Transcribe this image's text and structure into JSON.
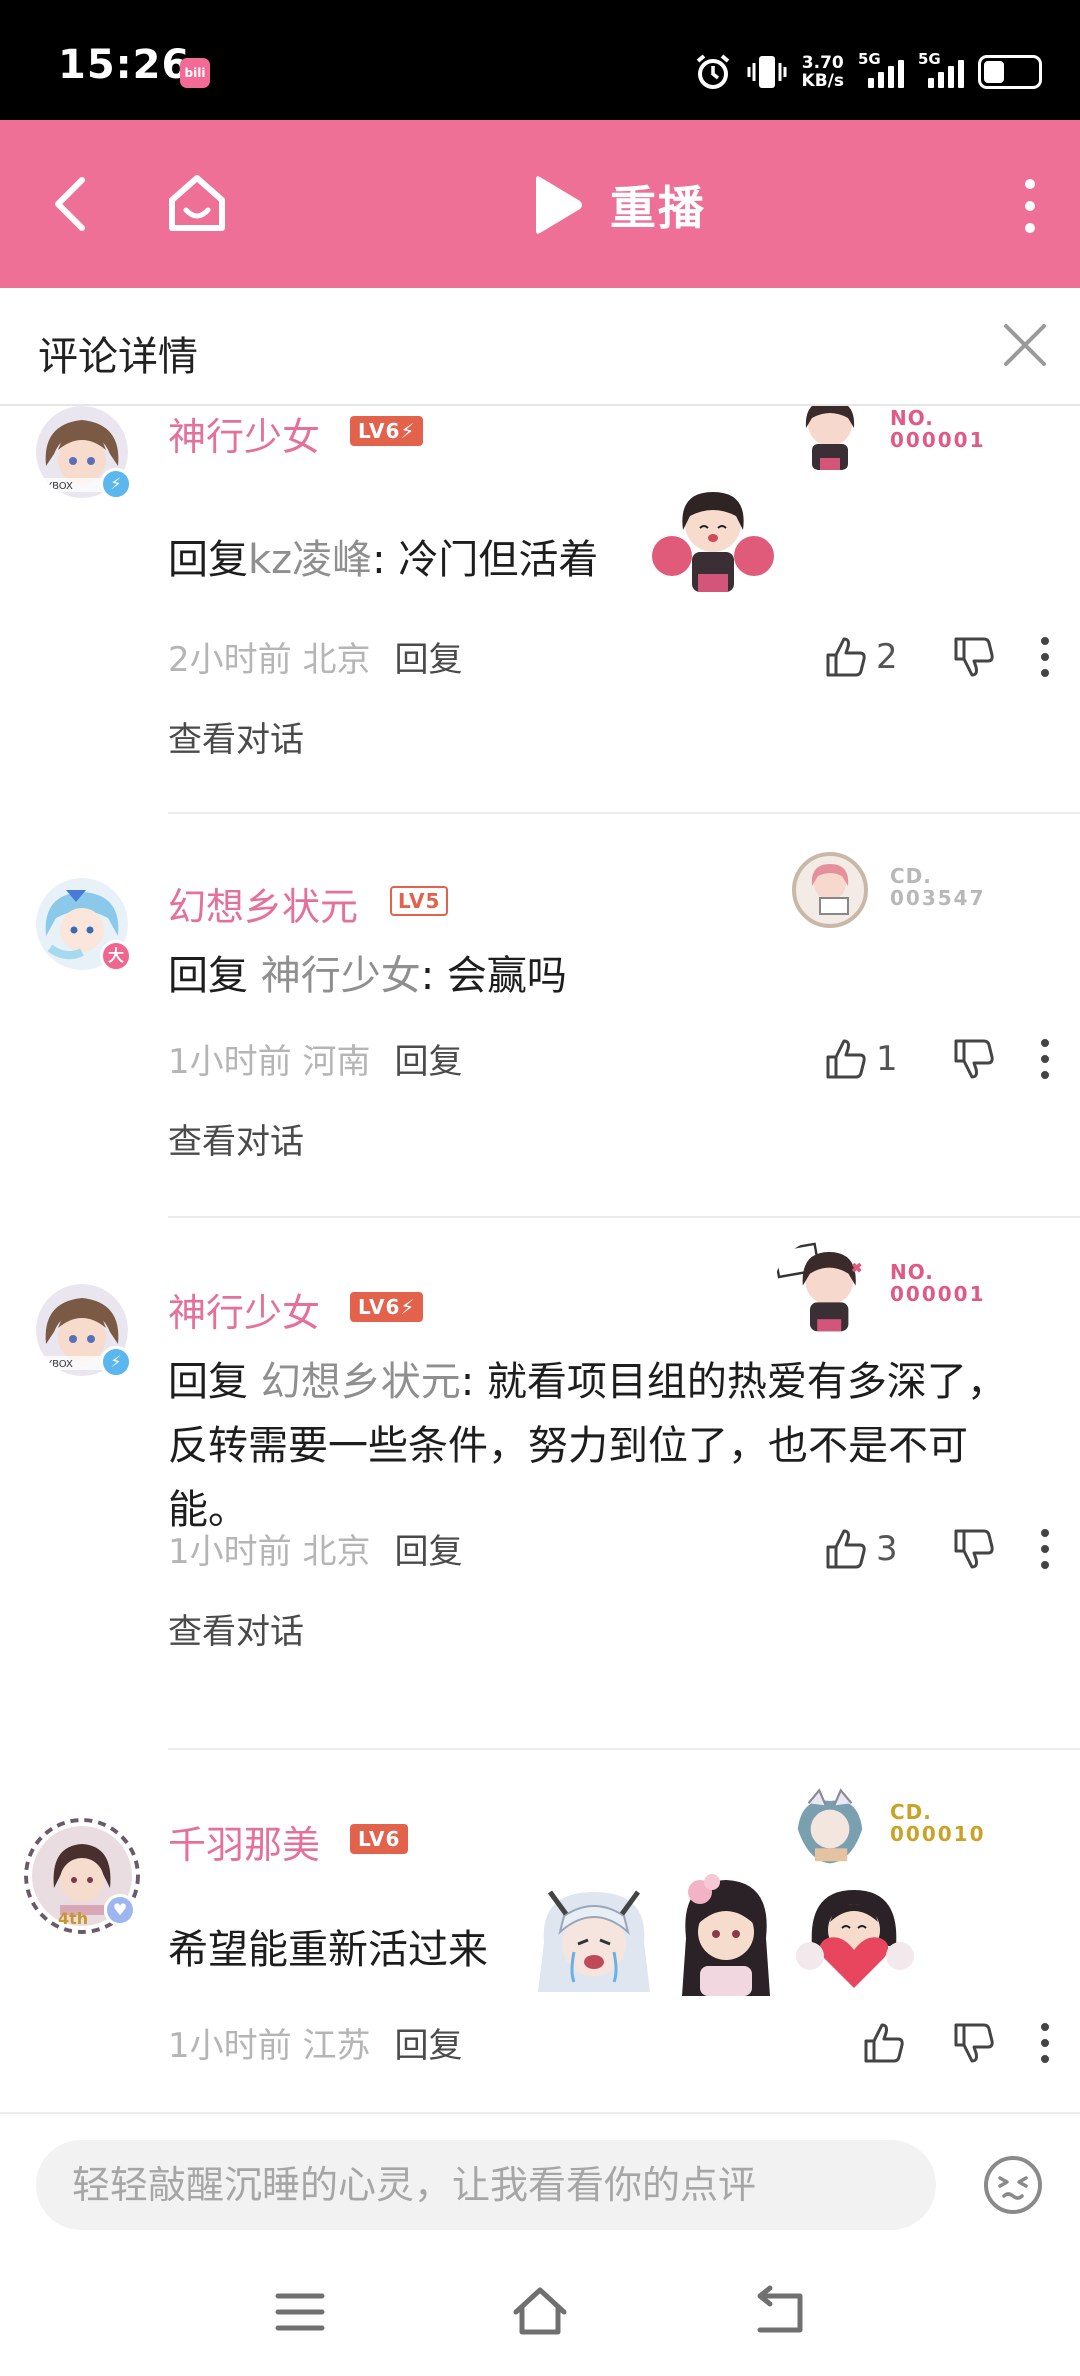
{
  "status_bar": {
    "time": "15:26",
    "app_icon_label": "bilibili",
    "net_speed_value": "3.70",
    "net_speed_unit": "KB/s",
    "sim1": "5G",
    "sim2": "5G",
    "battery_level": 0.34
  },
  "nav": {
    "replay_label": "重播",
    "icons": [
      "back-icon",
      "home-icon",
      "play-icon",
      "more-icon"
    ]
  },
  "panel": {
    "title": "评论详情"
  },
  "comments": [
    {
      "username": "神行少女",
      "level": "LV6⚡",
      "avatar_badge": "⚡",
      "medal_line1": "NO.",
      "medal_line2": "000001",
      "reply_prefix": "回复",
      "reply_to": "kz凌峰",
      "text": ": 冷门但活着",
      "time": "2小时前",
      "location": "北京",
      "reply_label": "回复",
      "likes": "2",
      "view_conversation": "查看对话"
    },
    {
      "username": "幻想乡状元",
      "level": "LV5",
      "avatar_badge": "大",
      "medal_line1": "CD.",
      "medal_line2": "003547",
      "reply_prefix": "回复",
      "reply_to": "神行少女",
      "text": ": 会赢吗",
      "time": "1小时前",
      "location": "河南",
      "reply_label": "回复",
      "likes": "1",
      "view_conversation": "查看对话"
    },
    {
      "username": "神行少女",
      "level": "LV6⚡",
      "avatar_badge": "⚡",
      "medal_line1": "NO.",
      "medal_line2": "000001",
      "reply_prefix": "回复",
      "reply_to": "幻想乡状元",
      "text": ": 就看项目组的热爱有多深了，反转需要一些条件，努力到位了，也不是不可能。",
      "time": "1小时前",
      "location": "北京",
      "reply_label": "回复",
      "likes": "3",
      "view_conversation": "查看对话"
    },
    {
      "username": "千羽那美",
      "level": "LV6",
      "avatar_badge": "♥",
      "medal_line1": "CD.",
      "medal_line2": "000010",
      "text": "希望能重新活过来",
      "time": "1小时前",
      "location": "江苏",
      "reply_label": "回复",
      "likes": ""
    }
  ],
  "input": {
    "placeholder": "轻轻敲醒沉睡的心灵，让我看看你的点评"
  },
  "colors": {
    "accent_pink": "#ee7097",
    "username_pink": "#e5709a",
    "level_orange": "#e2624c",
    "medal_pink": "#e05a84",
    "medal_gold": "#c9a227"
  }
}
